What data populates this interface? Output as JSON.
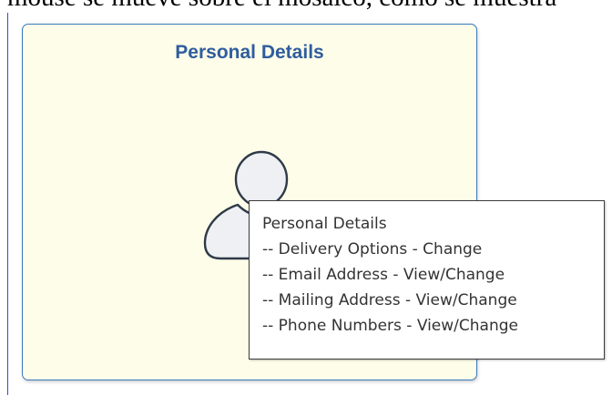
{
  "document": {
    "cut_off_text": "mouse se mueve sobre el mosaico, como se muestra"
  },
  "tile": {
    "title": "Personal Details",
    "icon": "person-edit-icon"
  },
  "tooltip": {
    "heading": "Personal Details",
    "items": [
      "-- Delivery Options - Change",
      "-- Email Address - View/Change",
      "-- Mailing Address - View/Change",
      "-- Phone Numbers - View/Change"
    ]
  },
  "colors": {
    "tile_background": "#fdfde9",
    "tile_border": "#3a7ac0",
    "title_text": "#2f5d9e",
    "tooltip_border": "#3c3c3c",
    "pencil_accent": "#e87a7a"
  }
}
